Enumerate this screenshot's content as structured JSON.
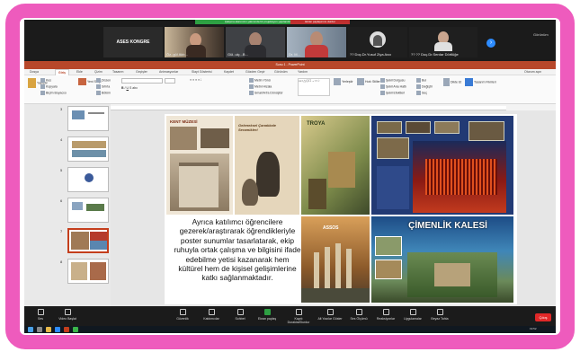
{
  "zoom": {
    "banner_green": "Çalışma alanınızın yakınında bir projeksiyon yapılandırması",
    "banner_red": "Ekran paylaşımını durdur",
    "tiles": [
      {
        "name": "ASES KONGRE",
        "text": "ASES KONGRE"
      },
      {
        "name": "Öz..gül Akb..."
      },
      {
        "name": "Gül..ulç...B..."
      },
      {
        "name": "Dr. M..."
      },
      {
        "name": "?? Doç.Dr.Yusuf Ziya Avcı"
      },
      {
        "name": "?? ?? Doç.Dr.Serdar Dörtlüğe"
      }
    ],
    "view_label": "Görünüm",
    "bottom_buttons": [
      "Ses",
      "Video Başlat",
      "Güvenlik",
      "Katılımcılar",
      "Sohbet",
      "Ekran paylaş",
      "Kaydı Duraklat/Durdur",
      "Alt Yazılar Göster",
      "Ses Ölçümü",
      "Reaksiyonlar",
      "Uygulamalar",
      "Beyaz Tahta"
    ],
    "leave_label": "Çıkış"
  },
  "ppt": {
    "title": "Sunu 1 - PowerPoint",
    "tabs": [
      "Dosya",
      "Giriş",
      "Ekle",
      "Çizim",
      "Tasarım",
      "Geçişler",
      "Animasyonlar",
      "Slayt Gösterisi",
      "Kaydet",
      "Gözden Geçir",
      "Görünüm",
      "Yardım"
    ],
    "active_tab": "Giriş",
    "ribbon": {
      "paste": "Yapıştır",
      "cut": "Kes",
      "copy": "Kopyala",
      "format_painter": "Biçim Boyacısı",
      "new_slide": "Yeni Slayt",
      "layout": "Düzen",
      "reset": "Sıfırla",
      "section": "Bölüm",
      "find": "Bul",
      "replace": "Değiştir",
      "select": "Seç",
      "dictate": "Dikte Et",
      "designer": "Tasarım Fikirleri",
      "shape_fill": "Şekil Dolgusu",
      "shape_outline": "Şekil Ana Hattı",
      "shape_effects": "Şekil Efektleri",
      "arrange": "Yerleştir",
      "quick_styles": "Hızlı Stiller",
      "text_direction": "Metin Yönü",
      "align_text": "Metni Hizala",
      "smartart": "SmartArt'a Dönüştür"
    },
    "status_right": "Oturum açın",
    "slide_numbers": [
      "3",
      "4",
      "5",
      "6",
      "7",
      "8"
    ],
    "slide_text": "Ayrıca katılımcı öğrencilere gezerek/araştırarak öğrendikleriyle poster sunumlar tasarlatarak, ekip ruhuyla ortak çalışma ve bilgisini ifade edebilme yetisi kazanarak hem kültürel hem de kişisel gelişimlerine katkı sağlanmaktadır.",
    "poster_titles": [
      "KENT MÜZESİ",
      "Geleneksel Çanakkale Seramikleri",
      "TROYA",
      "ASSOS",
      "ÇİMENLİK KALESİ"
    ]
  },
  "taskbar": {
    "time": "19:52"
  }
}
